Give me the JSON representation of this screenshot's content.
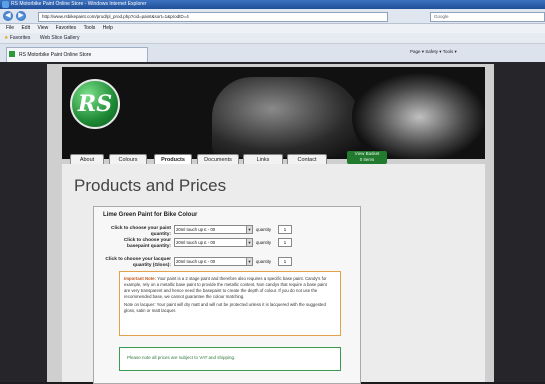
{
  "window": {
    "title": "RS Motorbike Paint Online Store - Windows Internet Explorer"
  },
  "address_bar": {
    "url": "http://www.rsbikepaint.com/prod/pl_prod.php?cid=paint&sort=1&prodID=4"
  },
  "search": {
    "placeholder": "Google"
  },
  "menu": [
    "File",
    "Edit",
    "View",
    "Favorites",
    "Tools",
    "Help"
  ],
  "favorites_bar": {
    "label": "Favorites",
    "extra": "Web Slice Gallery"
  },
  "tab": {
    "title": "RS Motorbike Paint Online Store"
  },
  "toolbar_right": "Page ▾  Safety ▾  Tools ▾",
  "site": {
    "logo": "RS",
    "nav": [
      "About",
      "Colours",
      "Products",
      "Documents",
      "Links",
      "Contact"
    ],
    "active_nav": "Products",
    "basket_label": "View Basket",
    "basket_sub": "0 items"
  },
  "page_title": "Products and Prices",
  "product": {
    "title": "Lime Green Paint for Bike Colour",
    "rows": [
      {
        "label": "Click to choose your paint quantity:",
        "selected": "20ml touch up £ - 00",
        "qty_label": "quantity",
        "qty": "1"
      },
      {
        "label": "Click to choose your basepaint quantity:",
        "selected": "20ml touch up £ - 00",
        "qty_label": "quantity",
        "qty": "1"
      },
      {
        "label": "Click to choose your lacquer quantity (Gloss):",
        "selected": "20ml touch up £ - 00",
        "qty_label": "quantity",
        "qty": "1"
      }
    ],
    "note_important": "Important Note:",
    "note_text": "Your paint is a 2 stage paint and therefore also requires a specific base paint. Candy's for example, rely on a metallic base paint to provide the metallic content. Non candys that require a base paint are very transparent and hence need the basepaint to create the depth of colour. If you do not use the recommended base, we cannot guarantee the colour matching.",
    "note_lacquer": "Note on lacquer: Your paint will dry matt and will not be protected unless it is lacquered with the suggested gloss, satin or matt lacquer.",
    "info": "Please note all prices are subject to VAT and shipping."
  }
}
